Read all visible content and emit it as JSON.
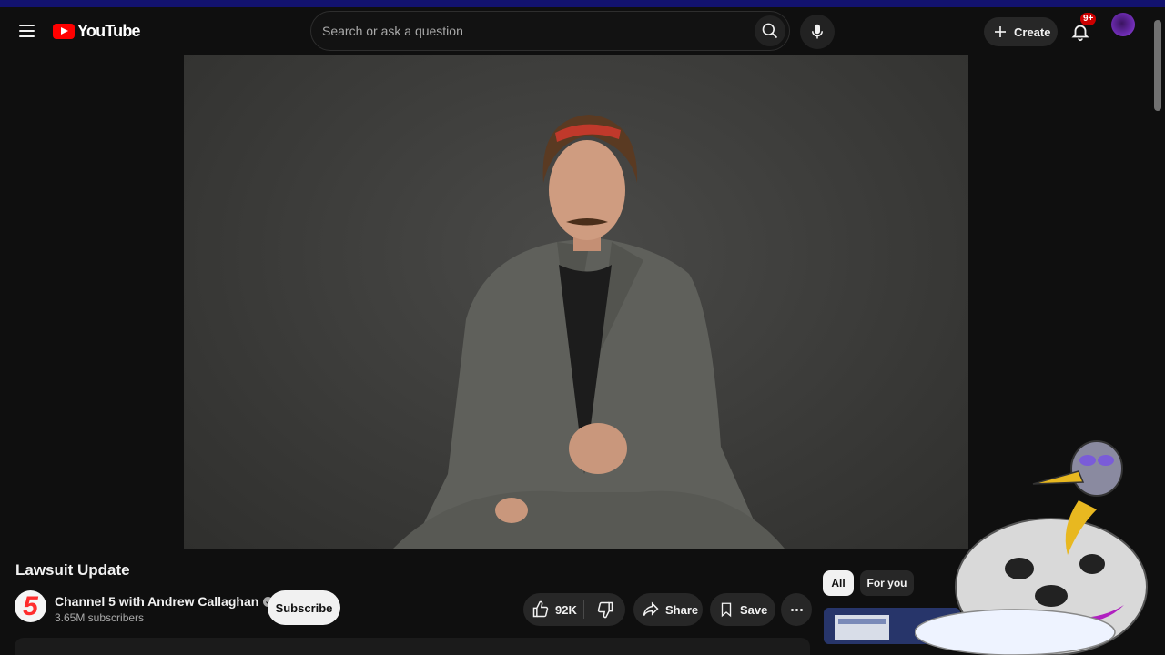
{
  "header": {
    "logo_text": "YouTube",
    "search_placeholder": "Search or ask a question",
    "create_label": "Create",
    "notification_badge": "9+"
  },
  "video": {
    "title": "Lawsuit Update"
  },
  "channel": {
    "avatar_text": "5",
    "name": "Channel 5 with Andrew Callaghan",
    "subscribers": "3.65M subscribers",
    "subscribe_label": "Subscribe"
  },
  "actions": {
    "like_count": "92K",
    "share_label": "Share",
    "save_label": "Save"
  },
  "sidebar": {
    "chips": [
      {
        "label": "All",
        "selected": true
      },
      {
        "label": "For you",
        "selected": false
      }
    ]
  },
  "colors": {
    "background": "#0f0f0f",
    "accent_red": "#ff0000",
    "button_bg": "#272727",
    "subscribe_bg": "#f1f1f1"
  }
}
